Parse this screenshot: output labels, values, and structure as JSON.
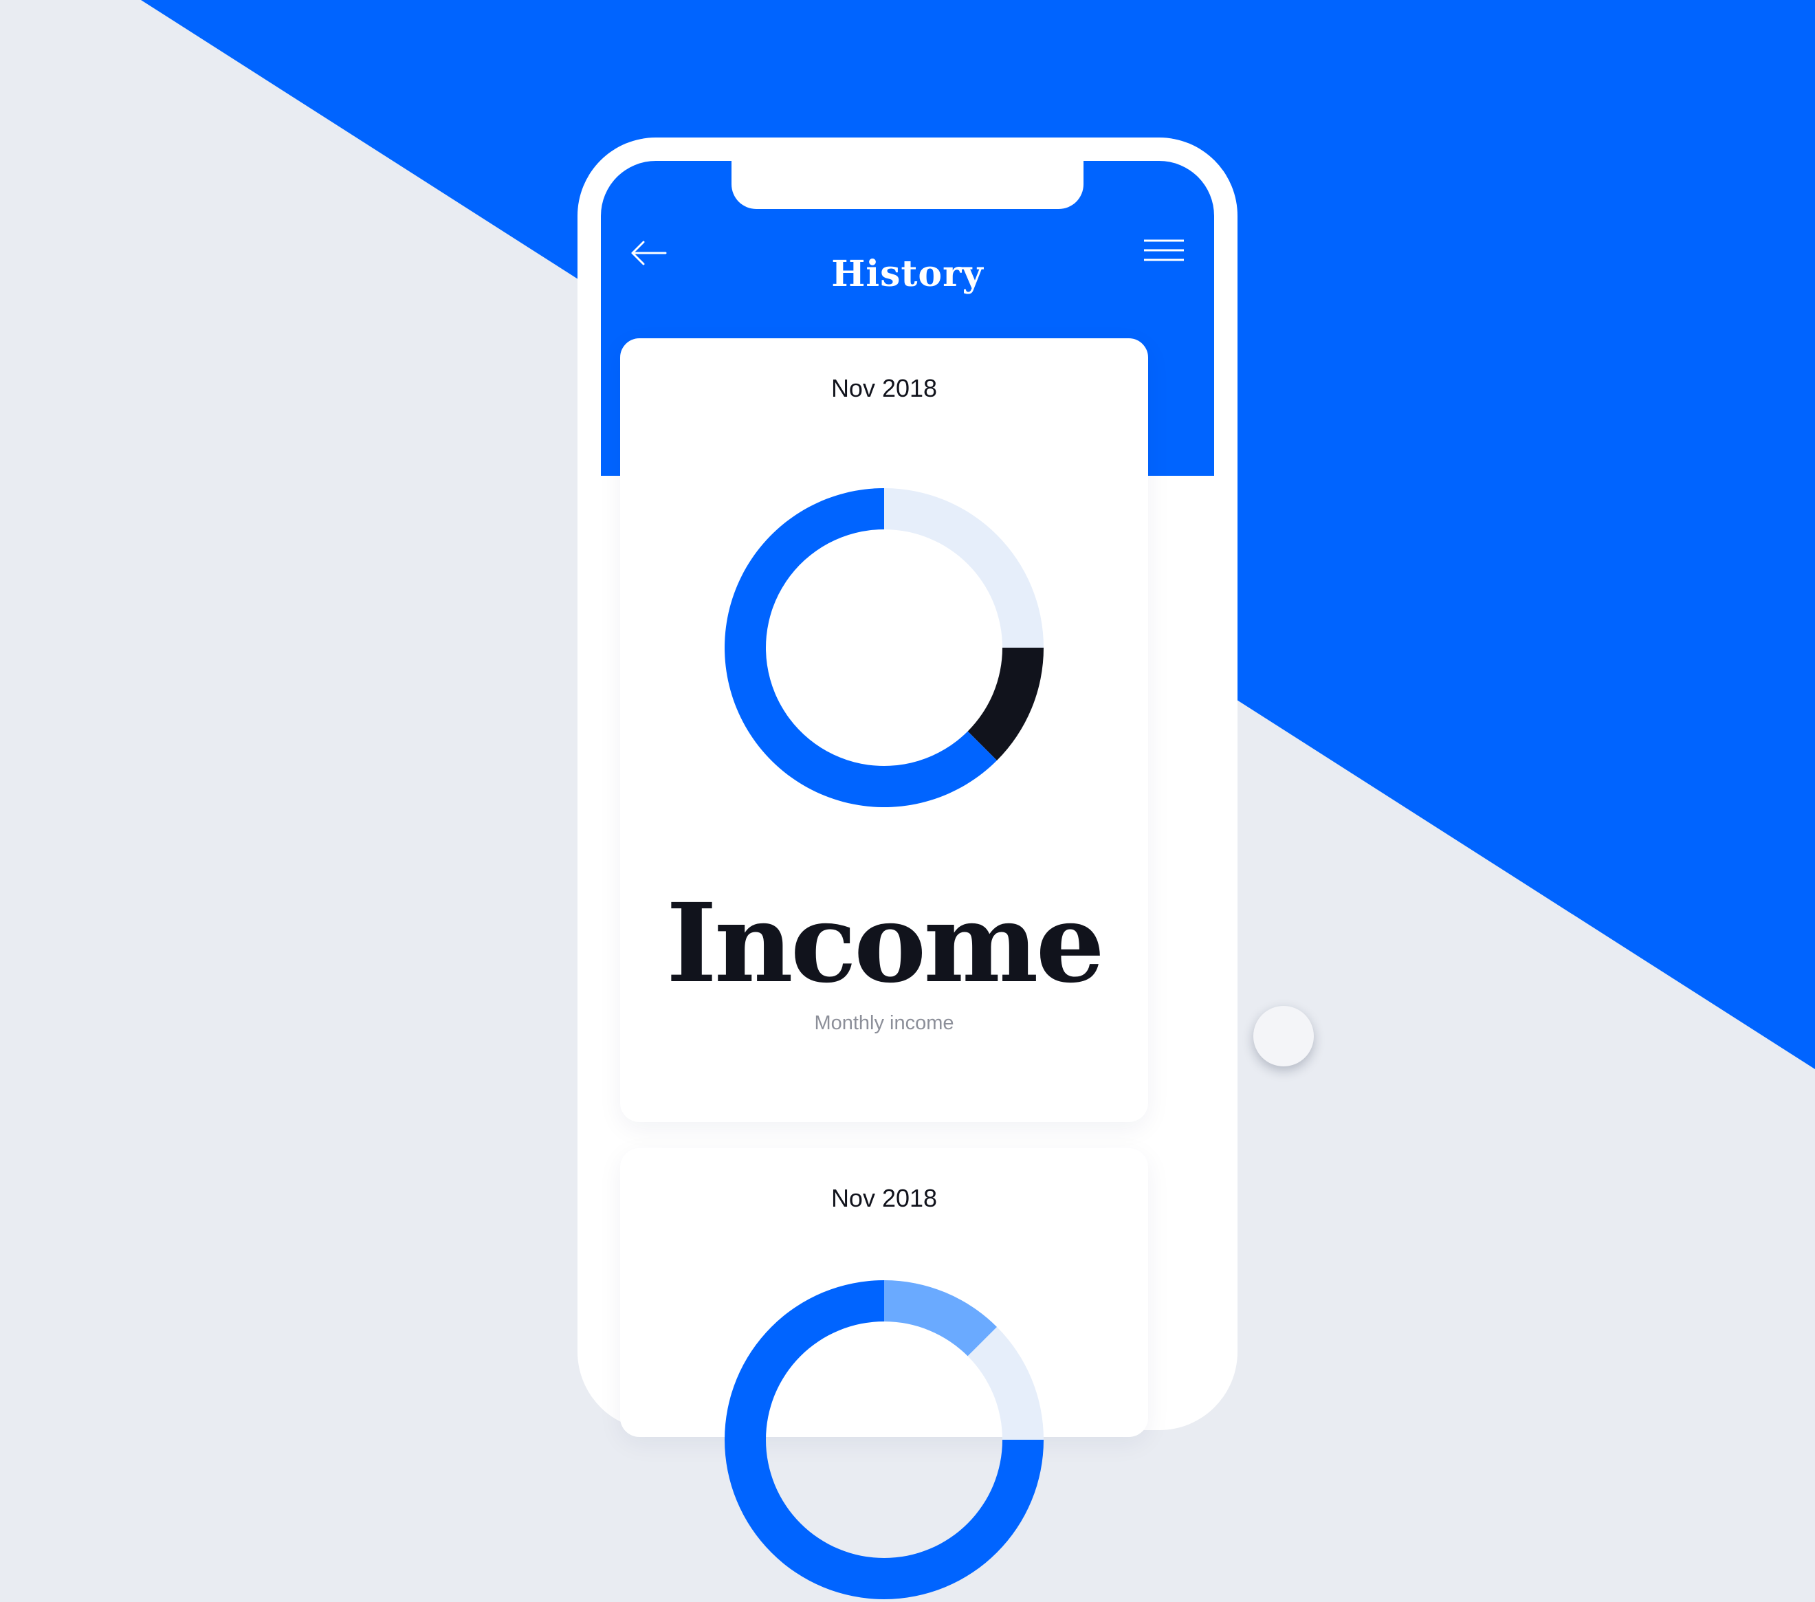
{
  "header": {
    "title": "History",
    "back_icon": "arrow-left-icon",
    "menu_icon": "hamburger-menu-icon"
  },
  "colors": {
    "accent": "#0064ff",
    "dark": "#11131c",
    "light_segment": "#e6eefa",
    "muted_text": "#8c8f99",
    "background": "#e9ecf2"
  },
  "cards": [
    {
      "date": "Nov 2018",
      "title": "Income",
      "subtitle": "Monthly income",
      "chart_data": {
        "type": "pie",
        "style": "donut",
        "series": [
          {
            "value": 25,
            "color": "#e6eefa"
          },
          {
            "value": 12.5,
            "color": "#11131c"
          },
          {
            "value": 62.5,
            "color": "#0064ff"
          }
        ]
      }
    },
    {
      "date": "Nov 2018",
      "chart_data": {
        "type": "pie",
        "style": "donut",
        "series": [
          {
            "value": 12.5,
            "color": "#6aaaff"
          },
          {
            "value": 12.5,
            "color": "#e6eefa"
          },
          {
            "value": 75,
            "color": "#0064ff"
          }
        ]
      }
    }
  ]
}
